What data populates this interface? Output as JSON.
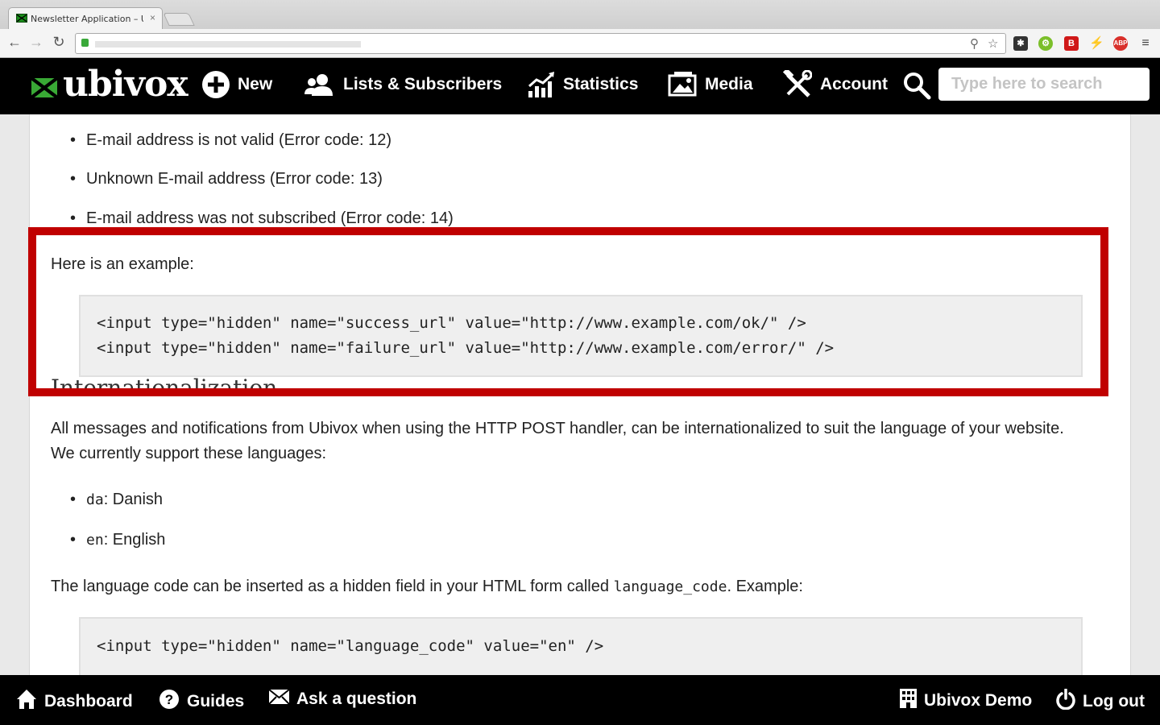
{
  "browser": {
    "tab_title": "Newsletter Application – U",
    "tab_close": "×"
  },
  "header": {
    "logo": "ubivox",
    "nav": {
      "new": "New",
      "lists": "Lists & Subscribers",
      "statistics": "Statistics",
      "media": "Media",
      "account": "Account"
    },
    "search_placeholder": "Type here to search"
  },
  "content": {
    "error_bullets": [
      "E-mail address is not valid (Error code: 12)",
      "Unknown E-mail address (Error code: 13)",
      "E-mail address was not subscribed (Error code: 14)"
    ],
    "example_intro": "Here is an example:",
    "example_code": [
      "<input type=\"hidden\" name=\"success_url\" value=\"http://www.example.com/ok/\" />",
      "<input type=\"hidden\" name=\"failure_url\" value=\"http://www.example.com/error/\" />"
    ],
    "i18n_heading": "Internationalization",
    "i18n_para": "All messages and notifications from Ubivox when using the HTTP POST handler, can be internationalized to suit the language of your website. We currently support these languages:",
    "languages": [
      {
        "code": "da",
        "name": ": Danish"
      },
      {
        "code": "en",
        "name": ": English"
      }
    ],
    "lang_para_before": "The language code can be inserted as a hidden field in your HTML form called ",
    "lang_para_code": "language_code",
    "lang_para_after": ". Example:",
    "lang_code_example": "<input type=\"hidden\" name=\"language_code\" value=\"en\" />"
  },
  "footer": {
    "dashboard": "Dashboard",
    "guides": "Guides",
    "ask": "Ask a question",
    "account_name": "Ubivox Demo",
    "logout": "Log out"
  },
  "colors": {
    "brand_green": "#39a935",
    "highlight_red": "#c00000",
    "bar_black": "#000000"
  }
}
